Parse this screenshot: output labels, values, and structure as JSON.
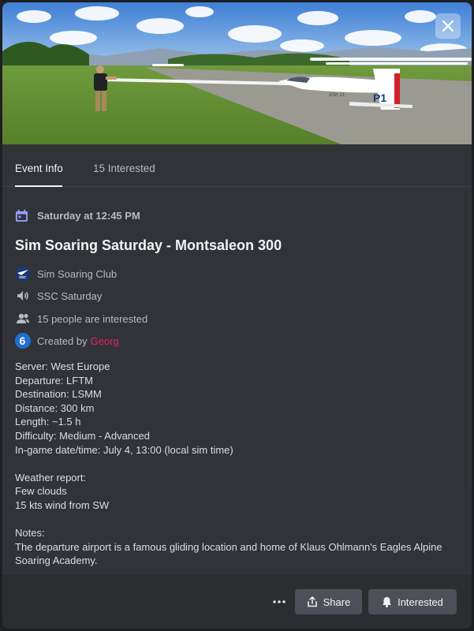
{
  "banner": {
    "tail_label": "P1",
    "wing_label": "ASK 21"
  },
  "close": {
    "icon": "close-icon"
  },
  "tabs": [
    {
      "label": "Event Info",
      "active": true
    },
    {
      "label": "15 Interested",
      "active": false
    }
  ],
  "event": {
    "date": "Saturday at 12:45 PM",
    "title": "Sim Soaring Saturday - Montsaleon 300",
    "server_name": "Sim Soaring Club",
    "server_icon_text": "SSC",
    "channel": "SSC Saturday",
    "interested_text": "15 people are interested",
    "created_by_label": "Created by ",
    "creator": "Georg",
    "creator_avatar_text": "6"
  },
  "description": {
    "lines": [
      "Server: West Europe",
      "Departure: LFTM",
      "Destination: LSMM",
      "Distance: 300 km",
      "Length: ~1.5 h",
      "Difficulty: Medium - Advanced",
      "In-game date/time: July 4, 13:00 (local sim time)",
      "",
      "Weather report:",
      "Few clouds",
      "15 kts wind from SW",
      "",
      "Notes:",
      "The departure airport is a famous gliding location and home of Klaus Ohlmann's Eagles Alpine",
      "Soaring Academy."
    ]
  },
  "footer": {
    "more_icon": "more-icon",
    "share_label": "Share",
    "interested_label": "Interested"
  },
  "colors": {
    "background": "#313338",
    "footer": "#2b2d31",
    "button": "#4e5058",
    "creator": "#e0245e",
    "calendar_icon": "#949cf7"
  }
}
